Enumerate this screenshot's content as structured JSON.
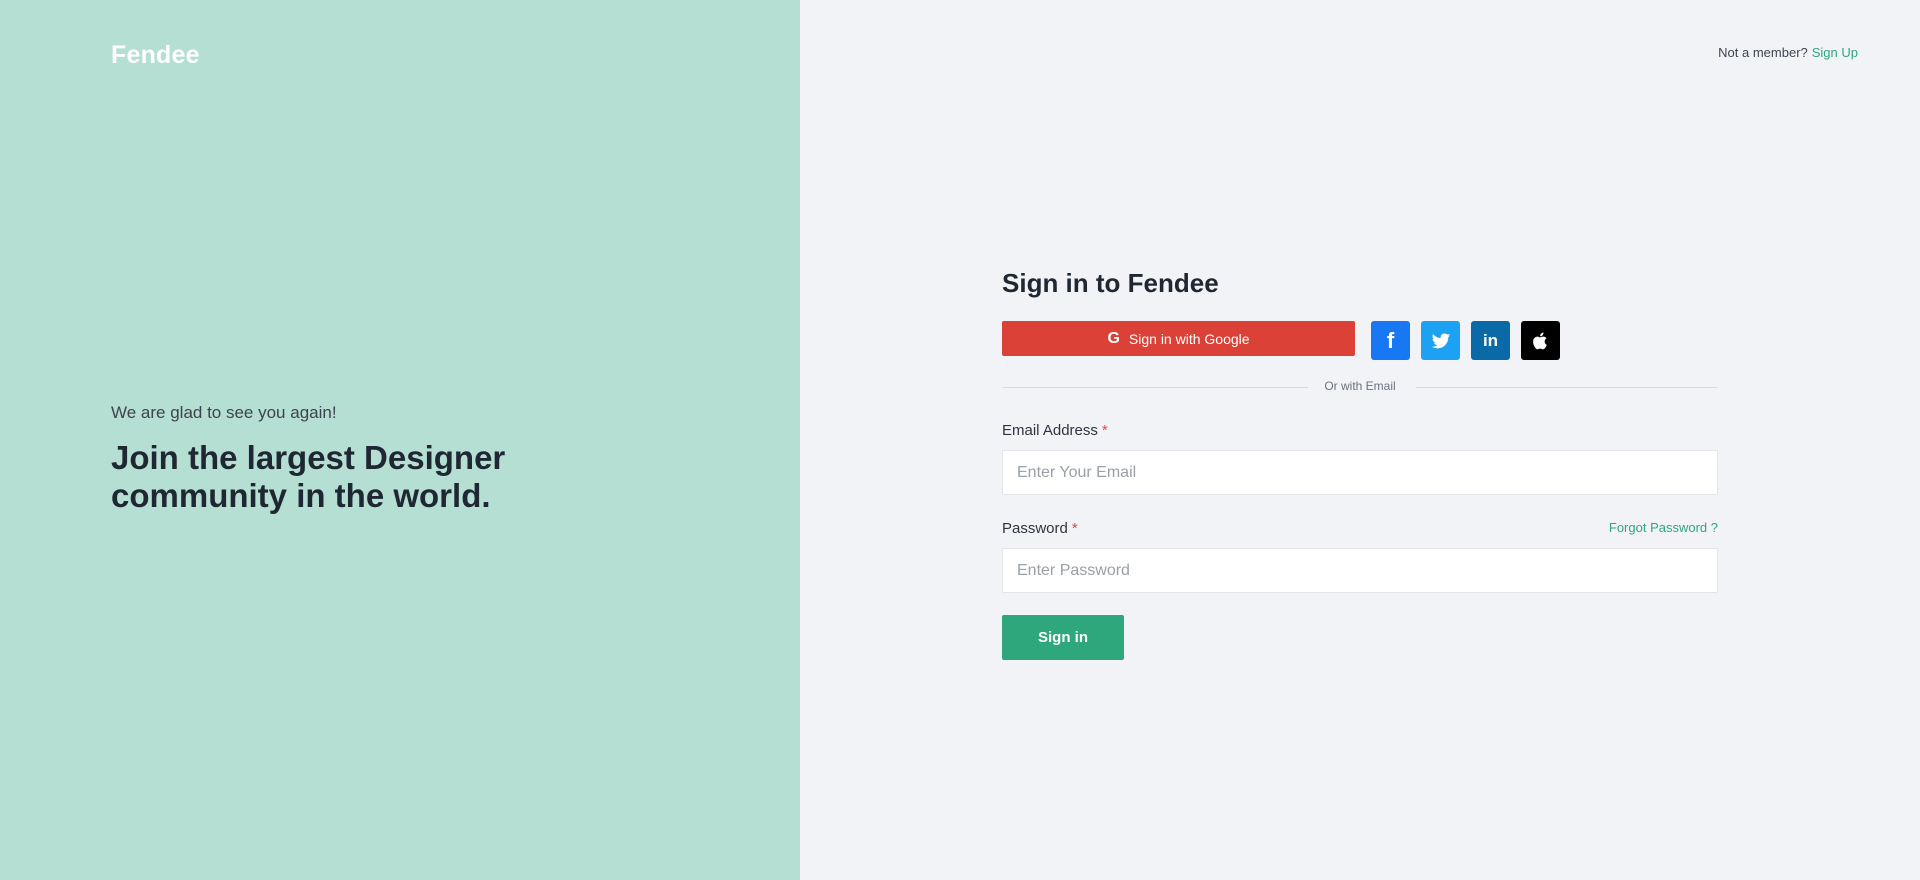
{
  "brand": {
    "logo_text": "Fendee"
  },
  "hero": {
    "welcome": "We are glad to see you again!",
    "headline": "Join the largest Designer community in the world."
  },
  "top_note": {
    "text": "Not a member?",
    "link": "Sign Up"
  },
  "form": {
    "title": "Sign in to Fendee",
    "google_label": "Sign in with Google",
    "social": [
      {
        "name": "facebook-icon",
        "glyph": "f"
      },
      {
        "name": "twitter-icon",
        "glyph": ""
      },
      {
        "name": "linkedin-icon",
        "glyph": "in"
      },
      {
        "name": "apple-icon",
        "glyph": ""
      }
    ],
    "divider": "Or with Email",
    "email_label": "Email Address",
    "email_placeholder": "Enter Your Email",
    "password_label": "Password",
    "password_placeholder": "Enter Password",
    "forgot": "Forgot Password ?",
    "required_mark": "*",
    "submit": "Sign in"
  },
  "colors": {
    "left_panel": "#b5dfd3",
    "page_bg": "#f2f3f7",
    "accent": "#2ea77c",
    "google": "#dc4137",
    "facebook": "#1877f2",
    "twitter": "#1da1f2",
    "linkedin": "#0a6aa8",
    "apple": "#000000"
  }
}
